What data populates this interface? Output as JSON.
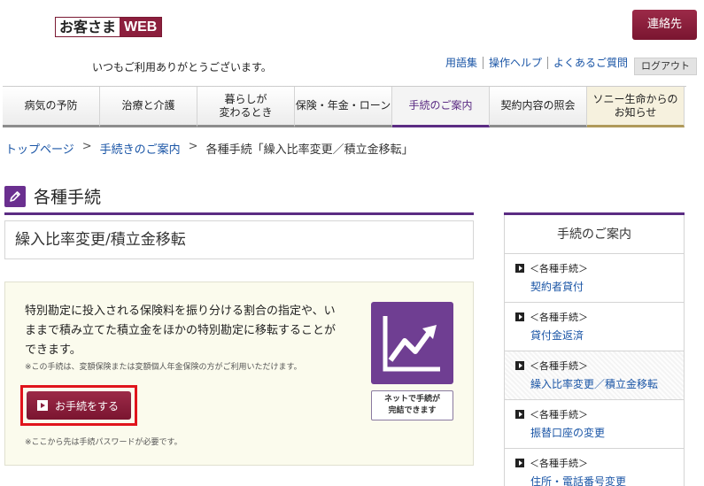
{
  "header": {
    "logo_part1": "お客さま",
    "logo_part2": "WEB",
    "contact_label": "連絡先",
    "greeting": "いつもご利用ありがとうございます。",
    "util_links": [
      "用語集",
      "操作ヘルプ",
      "よくあるご質問"
    ],
    "logout_label": "ログアウト"
  },
  "nav": {
    "items": [
      "病気の予防",
      "治療と介護",
      "暮らしが\n変わるとき",
      "保険・年金・ローン",
      "手続のご案内",
      "契約内容の照会",
      "ソニー生命からの\nお知らせ"
    ]
  },
  "breadcrumb": {
    "home": "トップページ",
    "sep": ">",
    "parent": "手続きのご案内",
    "current": "各種手続「繰入比率変更／積立金移転」"
  },
  "section": {
    "title": "各種手続"
  },
  "page": {
    "title": "繰入比率変更/積立金移転",
    "description": "特別勘定に投入される保険料を振り分ける割合の指定や、いままで積み立てた積立金をほかの特別勘定に移転することができます。",
    "note": "※この手続は、変額保険または変額個人年金保険の方がご利用いただけます。",
    "cta_label": "お手続をする",
    "password_note": "※ここから先は手続パスワードが必要です。",
    "online_badge": "ネットで手続が\n完結できます"
  },
  "sidebar": {
    "heading": "手続のご案内",
    "category_label": "＜各種手続＞",
    "items": [
      {
        "label": "契約者貸付"
      },
      {
        "label": "貸付金返済"
      },
      {
        "label": "繰入比率変更／積立金移転"
      },
      {
        "label": "振替口座の変更"
      },
      {
        "label": "住所・電話番号変更"
      }
    ]
  },
  "colors": {
    "brand": "#8c1f3d",
    "accent_purple": "#5b2c83",
    "link": "#1a55a6",
    "cta_highlight": "#e0141c"
  },
  "icons": {
    "section": "pencil-icon",
    "chart": "chart-up-icon",
    "play": "play-icon"
  }
}
